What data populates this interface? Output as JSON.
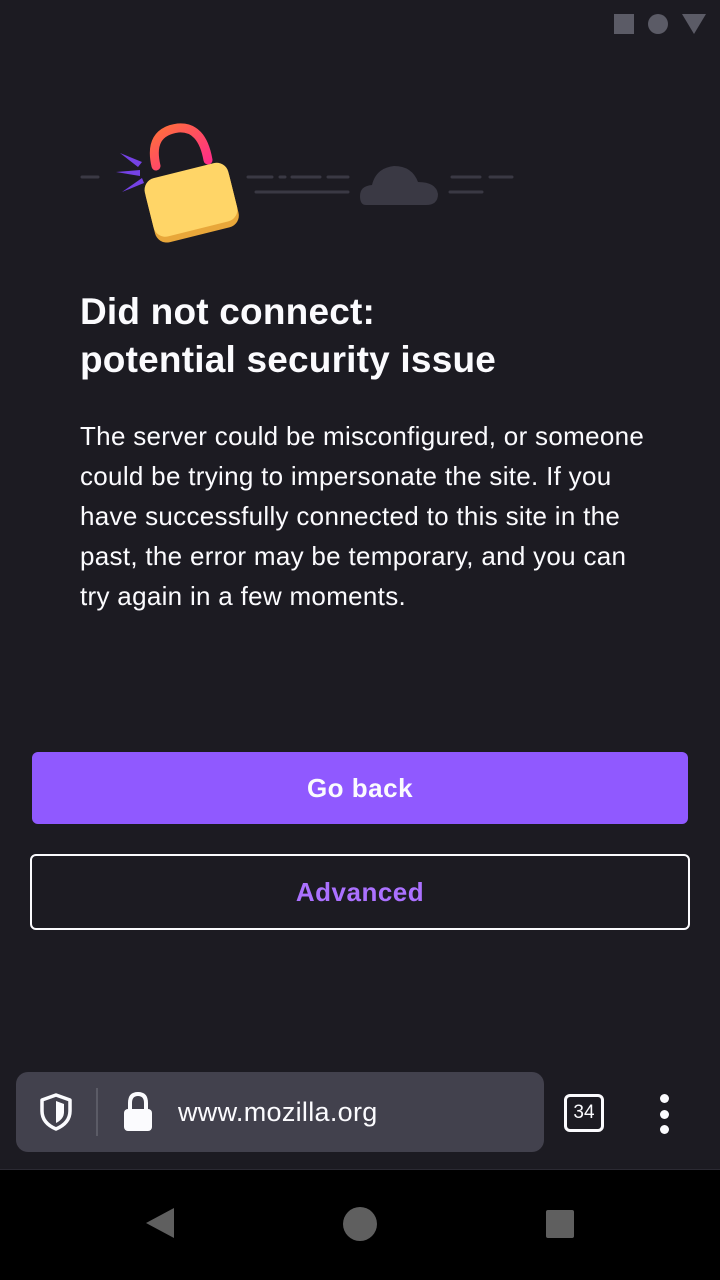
{
  "status_bar": {
    "icons": [
      "square-icon",
      "circle-icon",
      "triangle-icon"
    ]
  },
  "error_page": {
    "illustration": "broken-lock-cloud-illustration",
    "title_line1": "Did not connect:",
    "title_line2": "potential security issue",
    "description": "The server could be misconfigured, or someone could be trying to impersonate the site. If you have successfully connected to this site in the past, the error may be temporary, and you can try again in a few moments.",
    "go_back_label": "Go back",
    "advanced_label": "Advanced"
  },
  "toolbar": {
    "url": "www.mozilla.org",
    "tab_count": "34",
    "shield_icon": "tracking-protection-shield-icon",
    "lock_icon": "lock-icon",
    "menu_icon": "three-dot-menu-icon"
  },
  "nav_bar": {
    "buttons": [
      "back",
      "home",
      "recents"
    ]
  },
  "colors": {
    "background": "#1c1b22",
    "primary_button": "#9059ff",
    "advanced_text": "#ab71ff",
    "url_bar": "#42414d",
    "text": "#fbfbfe"
  }
}
